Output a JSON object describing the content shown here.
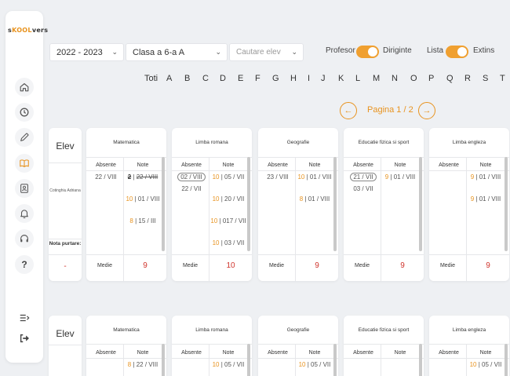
{
  "app": {
    "logo_s": "s",
    "logo_kool": "KOOL",
    "logo_vers": "vers"
  },
  "sidebar": {
    "items": [
      {
        "name": "home-icon"
      },
      {
        "name": "clock-icon"
      },
      {
        "name": "pencil-icon"
      },
      {
        "name": "book-icon",
        "active": true
      },
      {
        "name": "contact-icon"
      },
      {
        "name": "bell-icon"
      },
      {
        "name": "headset-icon"
      },
      {
        "name": "help-icon",
        "label": "?"
      },
      {
        "name": "collapse-menu-icon"
      },
      {
        "name": "logout-icon"
      }
    ]
  },
  "filters": {
    "year": "2022 - 2023",
    "class": "Clasa a 6-a A",
    "search_placeholder": "Cautare elev"
  },
  "toggles": {
    "role_left": "Profesor",
    "role_right": "Diriginte",
    "view_left": "Lista",
    "view_right": "Extins"
  },
  "letters": [
    "Toti",
    "A",
    "B",
    "C",
    "D",
    "E",
    "F",
    "G",
    "H",
    "I",
    "J",
    "K",
    "L",
    "M",
    "N",
    "O",
    "P",
    "Q",
    "R",
    "S",
    "T"
  ],
  "pager": {
    "label": "Pagina 1 / 2"
  },
  "labels": {
    "elev": "Elev",
    "absente": "Absente",
    "note": "Note",
    "medie": "Medie",
    "nota_purtare": "Nota purtare:"
  },
  "student1": {
    "name": "Cotinghiu Adriana",
    "nota_purtare": "-",
    "subjects": [
      {
        "name": "Matematica",
        "absente": [
          {
            "text": "22 / VIII"
          }
        ],
        "note": [
          {
            "v": "2",
            "d": "22 / VIII",
            "strike": true
          },
          {
            "v": "10",
            "d": "01 / VIII"
          },
          {
            "v": "8",
            "d": "15 / III"
          }
        ],
        "medie": "9"
      },
      {
        "name": "Limba romana",
        "absente": [
          {
            "text": "02 / VIII",
            "circled": true
          },
          {
            "text": "22 / VII"
          }
        ],
        "note": [
          {
            "v": "10",
            "d": "05 / VII"
          },
          {
            "v": "10",
            "d": "20 / VII"
          },
          {
            "v": "10",
            "d": "017 / VII"
          },
          {
            "v": "10",
            "d": "03 / VII"
          }
        ],
        "medie": "10"
      },
      {
        "name": "Geografie",
        "absente": [
          {
            "text": "23 / VIII"
          }
        ],
        "note": [
          {
            "v": "10",
            "d": "01 / VIII"
          },
          {
            "v": "8",
            "d": "01 / VIII"
          }
        ],
        "medie": "9"
      },
      {
        "name": "Educatie fizica si sport",
        "absente": [
          {
            "text": "21 / VII",
            "circled": true
          },
          {
            "text": "03 / VII"
          }
        ],
        "note": [
          {
            "v": "9",
            "d": "01 / VIII"
          }
        ],
        "medie": "9"
      },
      {
        "name": "Limba engleza",
        "absente": [],
        "note": [
          {
            "v": "9",
            "d": "01 / VIII"
          },
          {
            "v": "9",
            "d": "01 / VIII"
          }
        ],
        "medie": "9"
      }
    ]
  },
  "student2": {
    "subjects": [
      {
        "name": "Matematica",
        "note": [
          {
            "v": "8",
            "d": "22 / VIII"
          }
        ]
      },
      {
        "name": "Limba romana",
        "note": [
          {
            "v": "10",
            "d": "05 / VII"
          }
        ]
      },
      {
        "name": "Geografie",
        "note": [
          {
            "v": "10",
            "d": "05 / VII"
          }
        ]
      },
      {
        "name": "Educatie fizica si sport",
        "note": []
      },
      {
        "name": "Limba engleza",
        "note": [
          {
            "v": "10",
            "d": "05 / VII"
          }
        ]
      }
    ]
  },
  "colors": {
    "accent": "#e8931f",
    "grade_red": "#d0342c"
  }
}
